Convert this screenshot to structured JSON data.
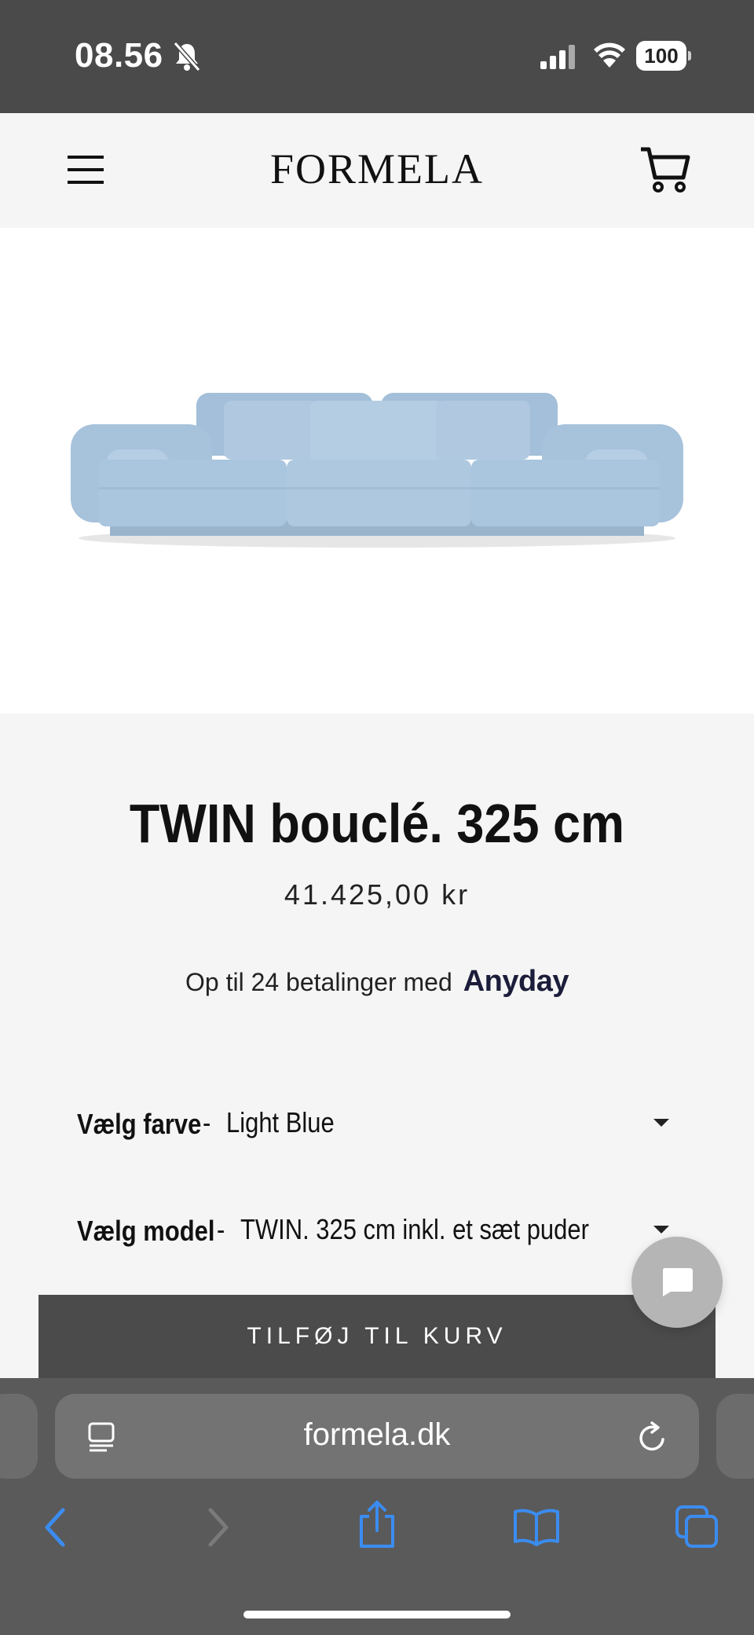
{
  "status_bar": {
    "time": "08.56",
    "battery": "100"
  },
  "header": {
    "logo": "FORMELA"
  },
  "product": {
    "title": "TWIN bouclé. 325 cm",
    "price": "41.425,00 kr",
    "installments_text": "Op til 24 betalinger med",
    "installments_brand": "Anyday"
  },
  "options": [
    {
      "label": "Vælg farve",
      "separator": "-",
      "value": "Light Blue"
    },
    {
      "label": "Vælg model",
      "separator": "-",
      "value": "TWIN. 325 cm inkl. et sæt puder"
    }
  ],
  "add_to_cart_label": "TILFØJ TIL KURV",
  "browser": {
    "url": "formela.dk"
  },
  "colors": {
    "accent_blue": "#3b8cf0",
    "sofa": "#a9c4de",
    "button_bg": "#4b4b4b"
  },
  "icons": [
    "bell-slash-icon",
    "signal-icon",
    "wifi-icon",
    "battery-icon",
    "hamburger-icon",
    "cart-icon",
    "chat-icon",
    "reader-icon",
    "reload-icon",
    "back-icon",
    "forward-icon",
    "share-icon",
    "bookmarks-icon",
    "tabs-icon"
  ]
}
